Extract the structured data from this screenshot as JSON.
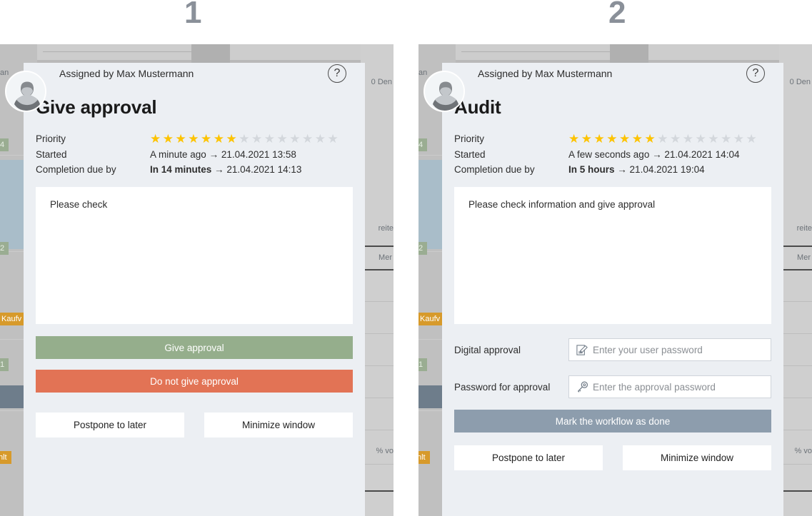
{
  "steps": [
    {
      "number": "1"
    },
    {
      "number": "2"
    }
  ],
  "colors": {
    "approve_green": "#95ae8c",
    "reject_red": "#e27355",
    "done_slate": "#8d9dad",
    "star_on": "#fdc300",
    "star_off": "#d3d7dc",
    "dialog_bg": "#eceff3"
  },
  "shared": {
    "assigned_by": "Assigned by Max Mustermann",
    "help_glyph": "?",
    "label_priority": "Priority",
    "label_started": "Started",
    "label_due": "Completion due by",
    "arrow": "→",
    "btn_postpone": "Postpone to later",
    "btn_minimize": "Minimize window",
    "stars_total": 15
  },
  "background": {
    "chip_4": "4",
    "chip_2": "2",
    "chip_kauf": "Kaufv",
    "chip_1": "1",
    "chip_hlt": "hlt",
    "text_an": "an",
    "text_den": "0 Den",
    "text_reite": "reite",
    "text_mer": "Mer",
    "text_percent": "% vo"
  },
  "panel1": {
    "title": "Give approval",
    "stars_filled": 7,
    "started_value": "A minute ago",
    "started_date": "21.04.2021 13:58",
    "due_value": "In 14 minutes",
    "due_date": "21.04.2021 14:13",
    "description": "Please check",
    "btn_primary": "Give approval",
    "btn_secondary": "Do not give approval"
  },
  "panel2": {
    "title": "Audit",
    "stars_filled": 7,
    "started_value": "A few seconds ago",
    "started_date": "21.04.2021 14:04",
    "due_value": "In 5 hours",
    "due_date": "21.04.2021 19:04",
    "description": "Please check information and give approval",
    "label_digital_approval": "Digital approval",
    "placeholder_user_password": "Enter your user password",
    "value_user_password": "",
    "label_password_approval": "Password for approval",
    "placeholder_approval_password": "Enter the approval password",
    "value_approval_password": "",
    "btn_done": "Mark the workflow as done"
  }
}
